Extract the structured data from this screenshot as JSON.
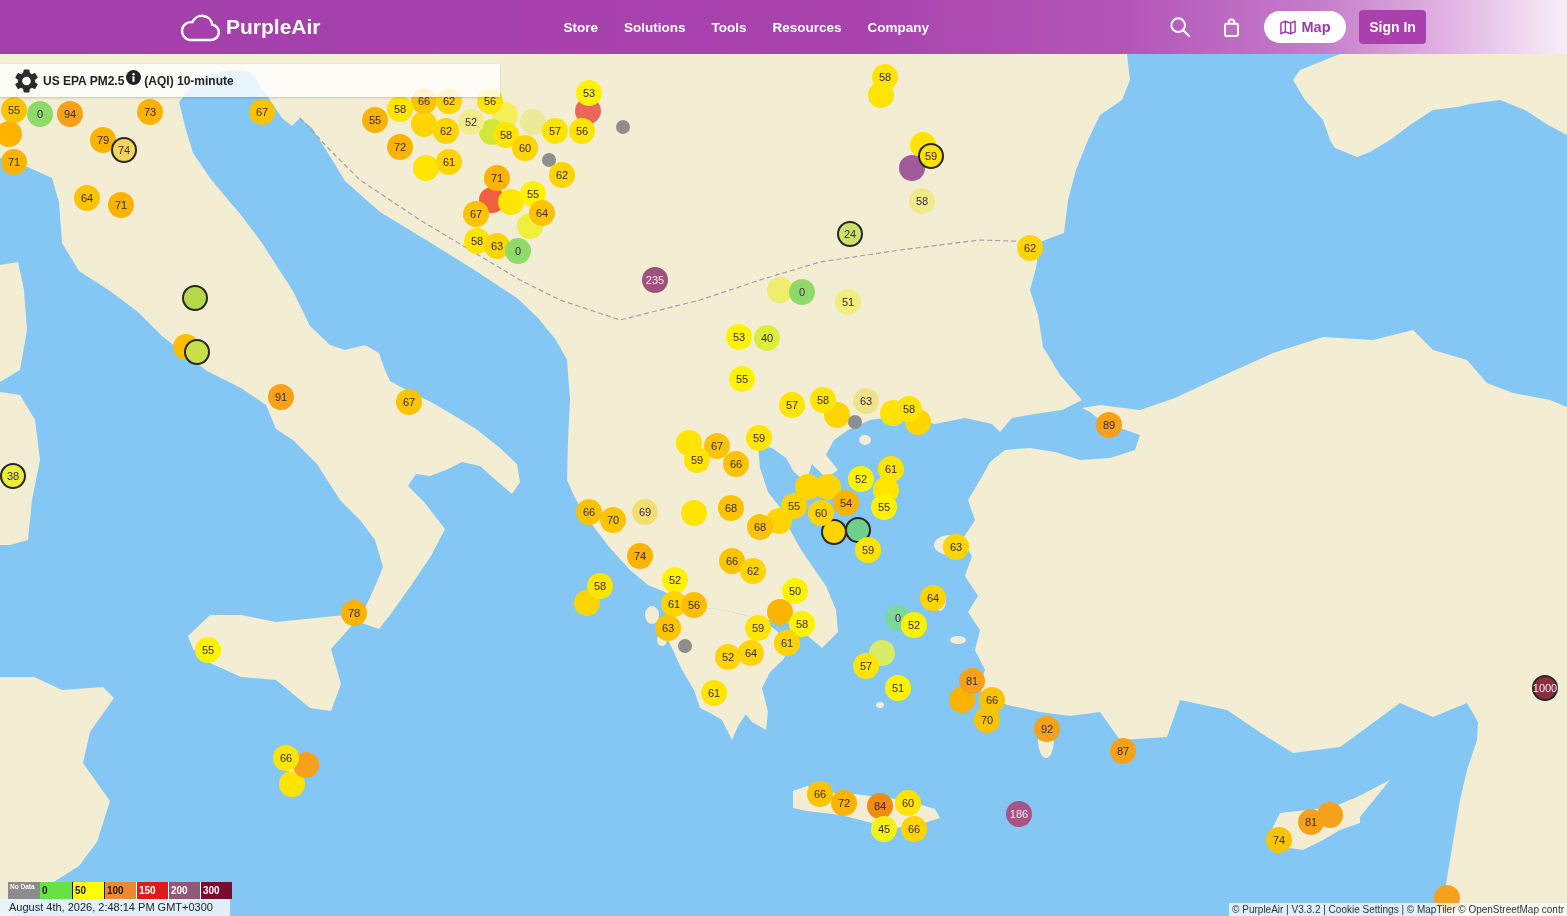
{
  "header": {
    "logo": "PurpleAir",
    "nav": [
      "Store",
      "Solutions",
      "Tools",
      "Resources",
      "Company"
    ],
    "map_button": "Map",
    "sign_in_button": "Sign In"
  },
  "layer_panel": {
    "metric": "US EPA PM2.5",
    "detail": "(AQI) 10-minute"
  },
  "markers": [
    {
      "kind": "sensor",
      "value": "58",
      "color": "#ffe400",
      "outlined": false
    },
    {
      "kind": "sensor",
      "value": "66",
      "color": "#fcc400",
      "outlined": false
    },
    {
      "kind": "sensor",
      "value": "62",
      "color": "#ffd400",
      "outlined": false
    },
    {
      "kind": "sensor",
      "value": "56",
      "color": "#ffe400",
      "outlined": false
    },
    {
      "kind": "sensor",
      "value": "53",
      "color": "#fff200",
      "outlined": false
    },
    {
      "kind": "sensor",
      "color": "#ffe400",
      "outlined": false
    },
    {
      "kind": "sensor",
      "value": "55",
      "color": "#fcc400",
      "outlined": false
    },
    {
      "kind": "sensor",
      "value": "0",
      "color": "#8edb6a",
      "outlined": false
    },
    {
      "kind": "sensor",
      "value": "94",
      "color": "#f7a11a",
      "outlined": false
    },
    {
      "kind": "sensor",
      "value": "73",
      "color": "#fbb300",
      "outlined": false
    },
    {
      "kind": "sensor",
      "value": "67",
      "color": "#fcc400",
      "outlined": false
    },
    {
      "kind": "sensor",
      "value": "55",
      "color": "#fbb300",
      "outlined": false
    },
    {
      "kind": "sensor",
      "value": "58",
      "color": "#ffe400",
      "outlined": false
    },
    {
      "kind": "sensor",
      "color": "#f2ef5a",
      "outlined": false
    },
    {
      "kind": "sensor",
      "color": "#e8685a",
      "outlined": false
    },
    {
      "kind": "sensor",
      "color": "#fbb300",
      "outlined": false
    },
    {
      "kind": "sensor",
      "color": "#ffd400",
      "outlined": false
    },
    {
      "kind": "sensor",
      "value": "62",
      "color": "#ffd400",
      "outlined": false
    },
    {
      "kind": "sensor",
      "value": "52",
      "color": "#f3ec8e",
      "outlined": false
    },
    {
      "kind": "sensor",
      "color": "#cde83a",
      "outlined": false
    },
    {
      "kind": "sensor",
      "color": "#ecea9a",
      "outlined": false
    },
    {
      "kind": "sensor",
      "value": "57",
      "color": "#ffe400",
      "outlined": false
    },
    {
      "kind": "sensor",
      "value": "56",
      "color": "#ffe400",
      "outlined": false
    },
    {
      "kind": "no-data",
      "color": "#8e8e8e",
      "outlined": false
    },
    {
      "kind": "sensor",
      "value": "79",
      "color": "#fbb300",
      "outlined": false
    },
    {
      "kind": "sensor",
      "value": "74",
      "color": "#f6d35a",
      "outlined": true
    },
    {
      "kind": "sensor",
      "value": "72",
      "color": "#fbb300",
      "outlined": false
    },
    {
      "kind": "sensor",
      "value": "58",
      "color": "#ffe400",
      "outlined": false
    },
    {
      "kind": "sensor",
      "value": "60",
      "color": "#ffd400",
      "outlined": false
    },
    {
      "kind": "no-data",
      "color": "#8e8e8e",
      "outlined": false
    },
    {
      "kind": "sensor",
      "color": "#ffe400",
      "outlined": false
    },
    {
      "kind": "sensor",
      "color": "#a05a9a",
      "outlined": false
    },
    {
      "kind": "sensor",
      "value": "59",
      "color": "#ffe400",
      "outlined": true
    },
    {
      "kind": "sensor",
      "value": "71",
      "color": "#fbb300",
      "outlined": false
    },
    {
      "kind": "sensor",
      "color": "#ffe400",
      "outlined": false
    },
    {
      "kind": "sensor",
      "value": "61",
      "color": "#ffd400",
      "outlined": false
    },
    {
      "kind": "sensor",
      "value": "71",
      "color": "#fbb300",
      "outlined": false
    },
    {
      "kind": "sensor",
      "value": "62",
      "color": "#ffd400",
      "outlined": false
    },
    {
      "kind": "sensor",
      "value": "64",
      "color": "#fcc400",
      "outlined": false
    },
    {
      "kind": "sensor",
      "value": "71",
      "color": "#fbb300",
      "outlined": false
    },
    {
      "kind": "sensor",
      "color": "#f06040",
      "outlined": false
    },
    {
      "kind": "sensor",
      "color": "#ffe400",
      "outlined": false
    },
    {
      "kind": "sensor",
      "value": "55",
      "color": "#fff200",
      "outlined": false
    },
    {
      "kind": "sensor",
      "value": "58",
      "color": "#f1e98a",
      "outlined": false
    },
    {
      "kind": "sensor",
      "value": "67",
      "color": "#fcc400",
      "outlined": false
    },
    {
      "kind": "sensor",
      "value": "64",
      "color": "#fcc400",
      "outlined": false
    },
    {
      "kind": "sensor",
      "color": "#eef03a",
      "outlined": false
    },
    {
      "kind": "sensor",
      "value": "24",
      "color": "#c9e36e",
      "outlined": true
    },
    {
      "kind": "sensor",
      "value": "58",
      "color": "#ffe400",
      "outlined": false
    },
    {
      "kind": "sensor",
      "value": "63",
      "color": "#ffd400",
      "outlined": false
    },
    {
      "kind": "sensor",
      "value": "0",
      "color": "#8edb6a",
      "outlined": false
    },
    {
      "kind": "sensor",
      "value": "62",
      "color": "#ffd400",
      "outlined": false
    },
    {
      "kind": "sensor",
      "value": "235",
      "color": "#a0527f",
      "outlined": false
    },
    {
      "kind": "sensor",
      "color": "#b4d84a",
      "outlined": true
    },
    {
      "kind": "sensor",
      "color": "#efec6e",
      "outlined": false
    },
    {
      "kind": "sensor",
      "value": "0",
      "color": "#8edb6a",
      "outlined": false
    },
    {
      "kind": "sensor",
      "value": "51",
      "color": "#f1ee80",
      "outlined": false
    },
    {
      "kind": "sensor",
      "color": "#fbbd00",
      "outlined": false
    },
    {
      "kind": "sensor",
      "value": "53",
      "color": "#fff200",
      "outlined": false
    },
    {
      "kind": "sensor",
      "value": "40",
      "color": "#d9ef3a",
      "outlined": false
    },
    {
      "kind": "sensor",
      "color": "#c8e04a",
      "outlined": true
    },
    {
      "kind": "sensor",
      "value": "55",
      "color": "#fff200",
      "outlined": false
    },
    {
      "kind": "sensor",
      "value": "91",
      "color": "#f7a11a",
      "outlined": false
    },
    {
      "kind": "sensor",
      "value": "67",
      "color": "#fcc400",
      "outlined": false
    },
    {
      "kind": "sensor",
      "value": "57",
      "color": "#ffe400",
      "outlined": false
    },
    {
      "kind": "sensor",
      "value": "58",
      "color": "#ffe400",
      "outlined": false
    },
    {
      "kind": "sensor",
      "value": "63",
      "color": "#efe38a",
      "outlined": false
    },
    {
      "kind": "sensor",
      "value": "58",
      "color": "#ffe400",
      "outlined": false
    },
    {
      "kind": "sensor",
      "color": "#ffd400",
      "outlined": false
    },
    {
      "kind": "no-data",
      "color": "#8e8e8e",
      "outlined": false
    },
    {
      "kind": "sensor",
      "color": "#ffe400",
      "outlined": false
    },
    {
      "kind": "sensor",
      "color": "#ffd400",
      "outlined": false
    },
    {
      "kind": "sensor",
      "value": "89",
      "color": "#f7a11a",
      "outlined": false
    },
    {
      "kind": "sensor",
      "color": "#ffe400",
      "outlined": false
    },
    {
      "kind": "sensor",
      "value": "67",
      "color": "#fcc400",
      "outlined": false
    },
    {
      "kind": "sensor",
      "value": "59",
      "color": "#ffe400",
      "outlined": false
    },
    {
      "kind": "sensor",
      "value": "59",
      "color": "#ffe400",
      "outlined": false
    },
    {
      "kind": "sensor",
      "value": "66",
      "color": "#fcc400",
      "outlined": false
    },
    {
      "kind": "sensor",
      "value": "61",
      "color": "#ffe400",
      "outlined": false
    },
    {
      "kind": "sensor",
      "value": "38",
      "color": "#eaf03a",
      "outlined": true
    },
    {
      "kind": "sensor",
      "value": "52",
      "color": "#fff200",
      "outlined": false
    },
    {
      "kind": "sensor",
      "color": "#ffd400",
      "outlined": false
    },
    {
      "kind": "sensor",
      "color": "#ffd400",
      "outlined": false
    },
    {
      "kind": "sensor",
      "color": "#ffe400",
      "outlined": false
    },
    {
      "kind": "sensor",
      "value": "66",
      "color": "#fcc400",
      "outlined": false
    },
    {
      "kind": "sensor",
      "value": "69",
      "color": "#f3df70",
      "outlined": false
    },
    {
      "kind": "sensor",
      "color": "#ffe400",
      "outlined": false
    },
    {
      "kind": "sensor",
      "value": "68",
      "color": "#fcc400",
      "outlined": false
    },
    {
      "kind": "sensor",
      "value": "55",
      "color": "#ffd400",
      "outlined": false
    },
    {
      "kind": "sensor",
      "value": "60",
      "color": "#ffd400",
      "outlined": false
    },
    {
      "kind": "sensor",
      "value": "54",
      "color": "#fbb300",
      "outlined": false
    },
    {
      "kind": "sensor",
      "value": "55",
      "color": "#fff200",
      "outlined": false
    },
    {
      "kind": "sensor",
      "value": "70",
      "color": "#fcc400",
      "outlined": false
    },
    {
      "kind": "sensor",
      "value": "68",
      "color": "#fcc400",
      "outlined": false
    },
    {
      "kind": "sensor",
      "color": "#ffd400",
      "outlined": false
    },
    {
      "kind": "sensor",
      "color": "#ffd400",
      "outlined": true
    },
    {
      "kind": "sensor",
      "color": "#6fcf8f",
      "outlined": true
    },
    {
      "kind": "sensor",
      "value": "74",
      "color": "#fbb300",
      "outlined": false
    },
    {
      "kind": "sensor",
      "value": "59",
      "color": "#ffe400",
      "outlined": false
    },
    {
      "kind": "sensor",
      "value": "63",
      "color": "#ffd400",
      "outlined": false
    },
    {
      "kind": "sensor",
      "value": "66",
      "color": "#fcc400",
      "outlined": false
    },
    {
      "kind": "sensor",
      "value": "62",
      "color": "#ffd400",
      "outlined": false
    },
    {
      "kind": "sensor",
      "value": "58",
      "color": "#ffe400",
      "outlined": false
    },
    {
      "kind": "sensor",
      "value": "52",
      "color": "#fff200",
      "outlined": false
    },
    {
      "kind": "sensor",
      "value": "50",
      "color": "#fff200",
      "outlined": false
    },
    {
      "kind": "sensor",
      "color": "#ffd400",
      "outlined": false
    },
    {
      "kind": "sensor",
      "value": "61",
      "color": "#ffd400",
      "outlined": false
    },
    {
      "kind": "sensor",
      "value": "56",
      "color": "#fbbf00",
      "outlined": false
    },
    {
      "kind": "sensor",
      "value": "64",
      "color": "#ffd400",
      "outlined": false
    },
    {
      "kind": "sensor",
      "value": "78",
      "color": "#fbb300",
      "outlined": false
    },
    {
      "kind": "sensor",
      "value": "63",
      "color": "#fcc400",
      "outlined": false
    },
    {
      "kind": "sensor",
      "value": "59",
      "color": "#ffe400",
      "outlined": false
    },
    {
      "kind": "sensor",
      "color": "#fbb300",
      "outlined": false
    },
    {
      "kind": "sensor",
      "value": "58",
      "color": "#fff200",
      "outlined": false
    },
    {
      "kind": "sensor",
      "value": "0",
      "color": "#7ed89a",
      "outlined": false
    },
    {
      "kind": "sensor",
      "value": "52",
      "color": "#fff200",
      "outlined": false
    },
    {
      "kind": "sensor",
      "value": "55",
      "color": "#fff200",
      "outlined": false
    },
    {
      "kind": "no-data",
      "color": "#8e8e8e",
      "outlined": false
    },
    {
      "kind": "sensor",
      "value": "52",
      "color": "#ffd400",
      "outlined": false
    },
    {
      "kind": "sensor",
      "value": "64",
      "color": "#ffd400",
      "outlined": false
    },
    {
      "kind": "sensor",
      "value": "61",
      "color": "#ffd400",
      "outlined": false
    },
    {
      "kind": "sensor",
      "color": "#d8ec6a",
      "outlined": false
    },
    {
      "kind": "sensor",
      "value": "57",
      "color": "#ffe400",
      "outlined": false
    },
    {
      "kind": "sensor",
      "value": "61",
      "color": "#ffe400",
      "outlined": false
    },
    {
      "kind": "sensor",
      "value": "51",
      "color": "#fff200",
      "outlined": false
    },
    {
      "kind": "sensor",
      "value": "81",
      "color": "#f7a11a",
      "outlined": false
    },
    {
      "kind": "sensor",
      "color": "#fbb300",
      "outlined": false
    },
    {
      "kind": "sensor",
      "value": "66",
      "color": "#fcc400",
      "outlined": false
    },
    {
      "kind": "sensor",
      "value": "1000",
      "color": "#8b2f3e",
      "outlined": true
    },
    {
      "kind": "sensor",
      "value": "70",
      "color": "#fcc400",
      "outlined": false
    },
    {
      "kind": "sensor",
      "value": "92",
      "color": "#f7a11a",
      "outlined": false
    },
    {
      "kind": "sensor",
      "value": "66",
      "color": "#ffe400",
      "outlined": false
    },
    {
      "kind": "sensor",
      "value": "87",
      "color": "#f7a11a",
      "outlined": false
    },
    {
      "kind": "sensor",
      "color": "#ffe400",
      "outlined": false
    },
    {
      "kind": "sensor",
      "color": "#f7a11a",
      "outlined": false
    },
    {
      "kind": "sensor",
      "value": "66",
      "color": "#fcc400",
      "outlined": false
    },
    {
      "kind": "sensor",
      "value": "72",
      "color": "#fbb300",
      "outlined": false
    },
    {
      "kind": "sensor",
      "value": "84",
      "color": "#f08c10",
      "outlined": false
    },
    {
      "kind": "sensor",
      "value": "60",
      "color": "#ffe400",
      "outlined": false
    },
    {
      "kind": "sensor",
      "value": "45",
      "color": "#f2f21a",
      "outlined": false
    },
    {
      "kind": "sensor",
      "value": "66",
      "color": "#ffd400",
      "outlined": false
    },
    {
      "kind": "sensor",
      "value": "186",
      "color": "#a85485",
      "outlined": false
    },
    {
      "kind": "sensor",
      "value": "81",
      "color": "#f7a11a",
      "outlined": false
    },
    {
      "kind": "sensor",
      "color": "#f7a11a",
      "outlined": false
    },
    {
      "kind": "sensor",
      "value": "74",
      "color": "#fcc400",
      "outlined": false
    },
    {
      "kind": "sensor",
      "color": "#f7a11a",
      "outlined": false
    }
  ],
  "legend": {
    "scale": [
      {
        "label": "No Data",
        "color": "#8c8c8c"
      },
      {
        "label": "0",
        "color": "#68e143"
      },
      {
        "label": "50",
        "color": "#ffff00"
      },
      {
        "label": "100",
        "color": "#ee8a2e"
      },
      {
        "label": "150",
        "color": "#e01b1b"
      },
      {
        "label": "200",
        "color": "#8e5a78"
      },
      {
        "label": "300",
        "color": "#7c0a2e"
      }
    ],
    "timestamp": "August 4th, 2026, 2:48:14 PM GMT+0300"
  },
  "attribution": "© PurpleAir | V3.3.2 | Cookie Settings | © MapTiler © OpenStreetMap contr"
}
